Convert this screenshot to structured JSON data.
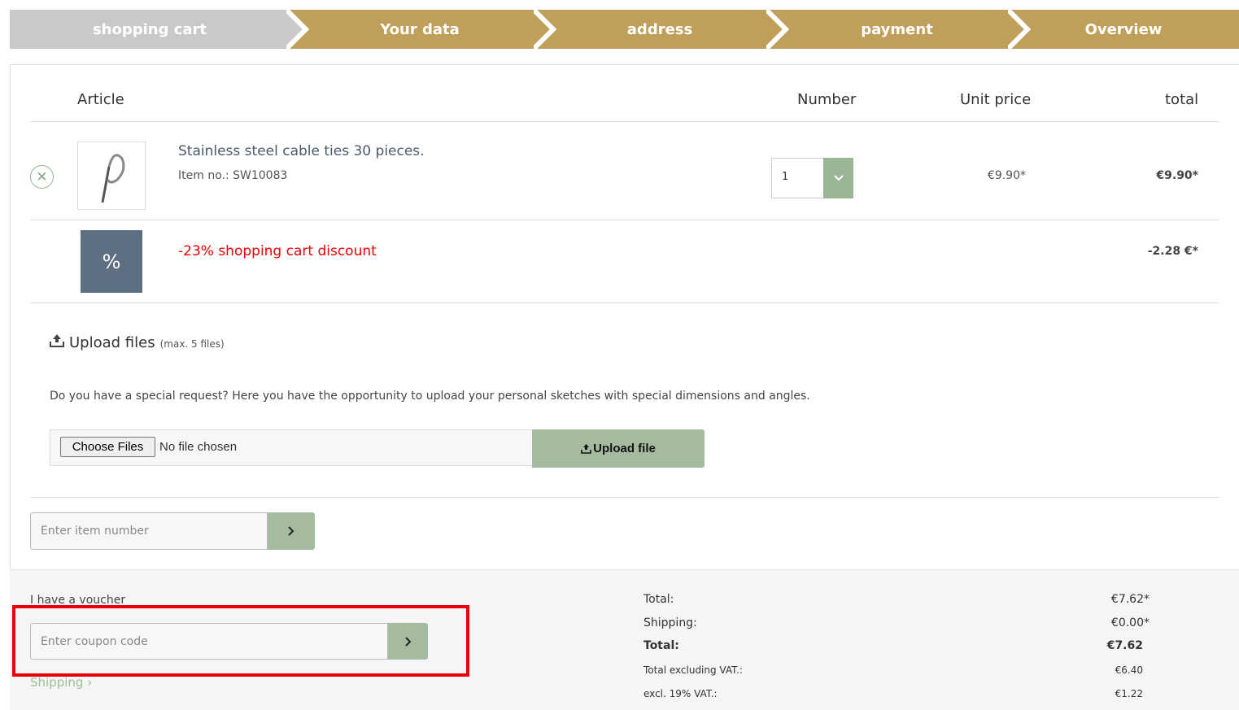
{
  "steps": [
    "shopping cart",
    "Your data",
    "address",
    "payment",
    "Overview"
  ],
  "table": {
    "headers": {
      "article": "Article",
      "number": "Number",
      "unit_price": "Unit price",
      "total": "total"
    }
  },
  "item": {
    "title": "Stainless steel cable ties 30 pieces.",
    "item_no": "Item no.: SW10083",
    "quantity": "1",
    "unit_price": "€9.90*",
    "total": "€9.90*"
  },
  "discount": {
    "icon": "%",
    "label": "-23% shopping cart discount",
    "value": "-2.28 €*"
  },
  "upload": {
    "title": "Upload files",
    "subtitle": "(max. 5 files)",
    "description": "Do you have a special request? Here you have the opportunity to upload your personal sketches with special dimensions and angles.",
    "choose_label": "Choose Files",
    "no_file": "No file chosen",
    "button_label": "Upload file"
  },
  "quick_add": {
    "placeholder": "Enter item number"
  },
  "voucher": {
    "label": "I have a voucher",
    "placeholder": "Enter coupon code"
  },
  "shipping_link": "Shipping",
  "summary": [
    {
      "label": "Total:",
      "value": "€7.62*"
    },
    {
      "label": "Shipping:",
      "value": "€0.00*"
    },
    {
      "label": "Total:",
      "value": "€7.62"
    },
    {
      "label": "Total excluding VAT.:",
      "value": "€6.40"
    },
    {
      "label": "excl. 19% VAT.:",
      "value": "€1.22"
    }
  ],
  "colors": {
    "step_active": "#c9c9c9",
    "step_inactive": "#bf9f5a",
    "accent_green": "#a4bb9f",
    "discount_red": "#ee0000",
    "discount_box": "#5f6f82",
    "highlight": "#e8000b"
  },
  "icons": {
    "remove": "close-icon",
    "qty_dropdown": "chevron-down-icon",
    "upload": "upload-icon",
    "submit": "chevron-right-icon"
  }
}
